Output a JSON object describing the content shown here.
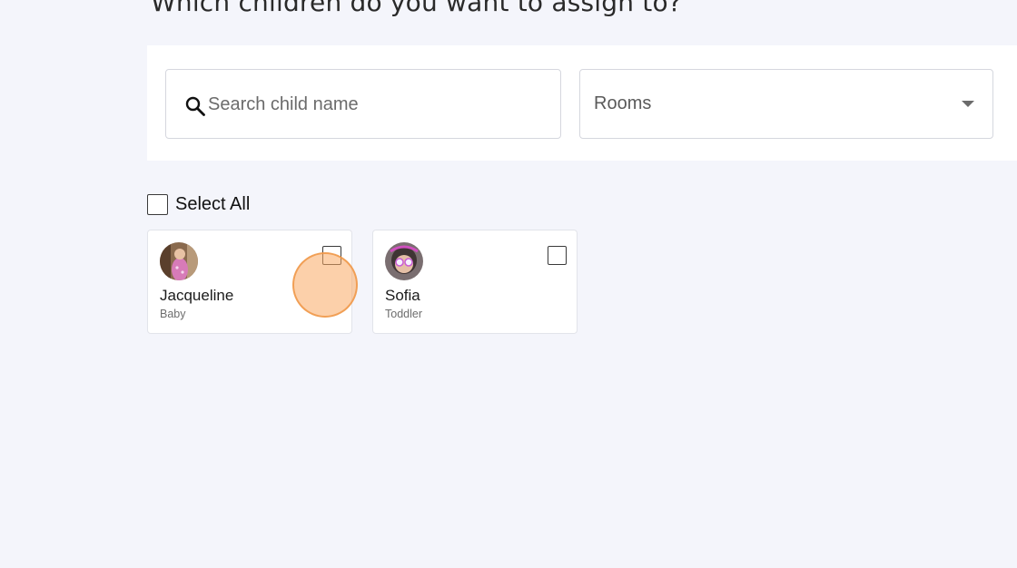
{
  "page": {
    "heading": "Which children do you want to assign to?"
  },
  "filters": {
    "search_placeholder": "Search child name",
    "search_value": "",
    "rooms_label": "Rooms"
  },
  "select_all": {
    "label": "Select All",
    "checked": false
  },
  "children": [
    {
      "name": "Jacqueline",
      "room": "Baby",
      "checked": false
    },
    {
      "name": "Sofia",
      "room": "Toddler",
      "checked": false
    }
  ],
  "colors": {
    "background": "#f4f5fb",
    "panel": "#ffffff",
    "border": "#d5d7de",
    "click_marker": "#f5a15e"
  }
}
